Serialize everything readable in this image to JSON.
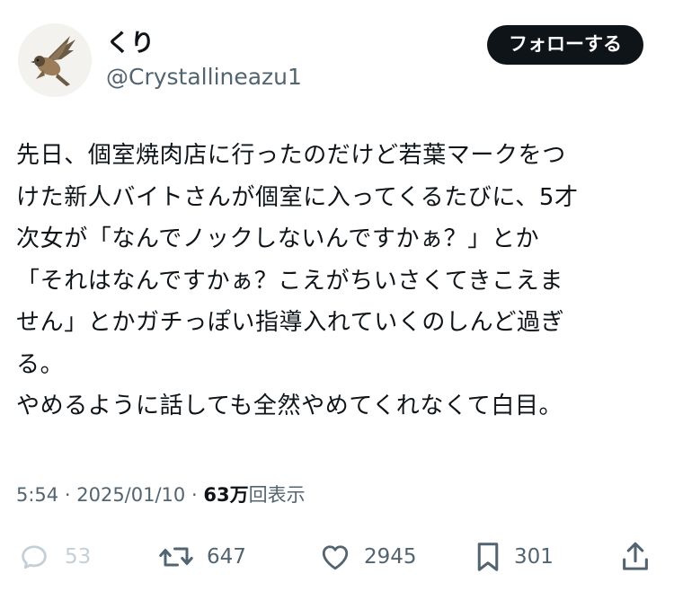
{
  "author": {
    "display_name": "くり",
    "handle": "@Crystallineazu1"
  },
  "follow_button": {
    "label": "フォローする"
  },
  "tweet": {
    "text": "先日、個室焼肉店に行ったのだけど若葉マークをつ\nけた新人バイトさんが個室に入ってくるたびに、5才\n次女が「なんでノックしないんですかぁ？」とか\n「それはなんですかぁ？こえがちいさくてきこえま\nせん」とかガチっぽい指導入れていくのしんど過ぎ\nる。\nやめるように話しても全然やめてくれなくて白目。"
  },
  "meta": {
    "time": "5:54",
    "separator": "·",
    "date": "2025/01/10",
    "views_count": "63万",
    "views_label": "回表示"
  },
  "actions": {
    "reply": {
      "icon": "reply-icon",
      "count": "53"
    },
    "retweet": {
      "icon": "retweet-icon",
      "count": "647"
    },
    "like": {
      "icon": "heart-icon",
      "count": "2945"
    },
    "bookmark": {
      "icon": "bookmark-icon",
      "count": "301"
    },
    "share": {
      "icon": "share-icon"
    }
  },
  "colors": {
    "text": "#0f1419",
    "secondary": "#536471",
    "follow_button_bg": "#0f1419",
    "follow_button_text": "#ffffff"
  }
}
